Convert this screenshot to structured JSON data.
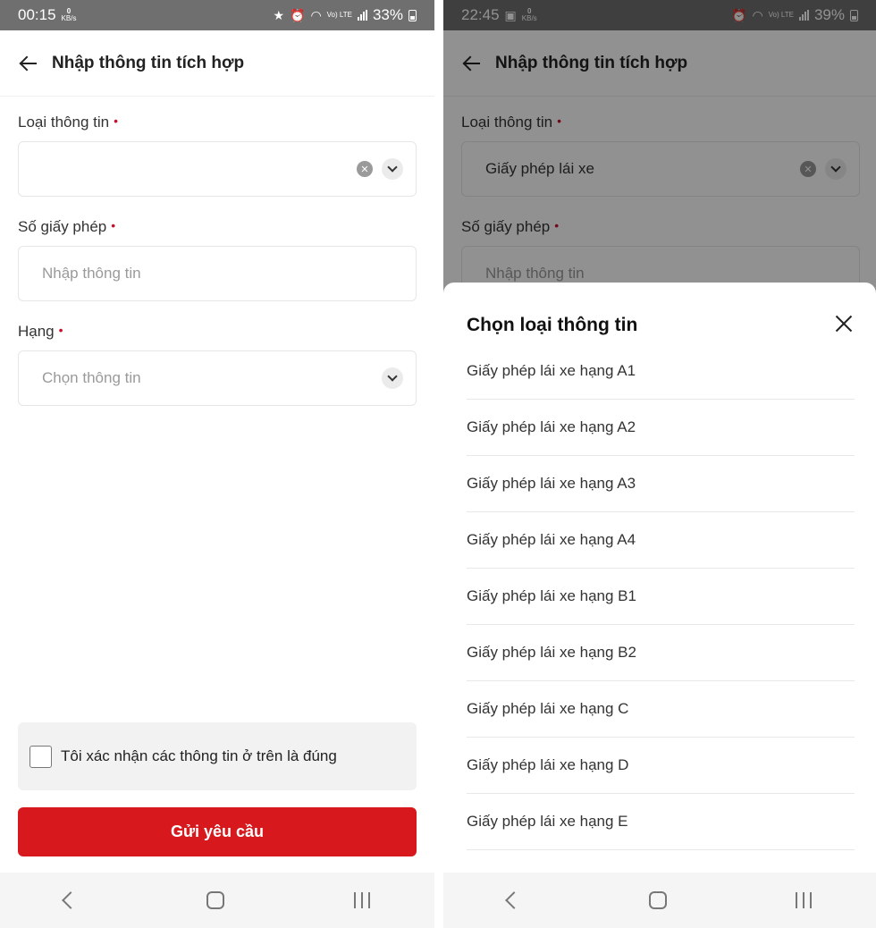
{
  "left": {
    "status": {
      "time": "00:15",
      "speed": "0",
      "speed_unit": "KB/s",
      "lte": "Vo) LTE",
      "battery": "33%"
    },
    "header": {
      "title": "Nhập thông tin tích hợp"
    },
    "fields": {
      "type_label": "Loại thông tin",
      "type_value": "",
      "license_label": "Số giấy phép",
      "license_placeholder": "Nhập thông tin",
      "class_label": "Hạng",
      "class_placeholder": "Chọn thông tin",
      "required_mark": "•"
    },
    "confirm_text": "Tôi xác nhận các thông tin ở trên là đúng",
    "submit_label": "Gửi yêu cầu"
  },
  "right": {
    "status": {
      "time": "22:45",
      "speed": "0",
      "speed_unit": "KB/s",
      "lte": "Vo) LTE",
      "battery": "39%"
    },
    "header": {
      "title": "Nhập thông tin tích hợp"
    },
    "fields": {
      "type_label": "Loại thông tin",
      "type_value": "Giấy phép lái xe",
      "license_label": "Số giấy phép",
      "license_placeholder": "Nhập thông tin",
      "required_mark": "•"
    },
    "sheet": {
      "title": "Chọn loại thông tin",
      "options": [
        "Giấy phép lái xe hạng A1",
        "Giấy phép lái xe hạng A2",
        "Giấy phép lái xe hạng A3",
        "Giấy phép lái xe hạng A4",
        "Giấy phép lái xe hạng B1",
        "Giấy phép lái xe hạng B2",
        "Giấy phép lái xe hạng C",
        "Giấy phép lái xe hạng D",
        "Giấy phép lái xe hạng E"
      ]
    }
  },
  "colors": {
    "primary": "#d7191e",
    "required": "#c8102e",
    "statusbar": "#6f6f6f"
  },
  "icons": [
    "back-arrow-icon",
    "clear-icon",
    "chevron-down-icon",
    "close-icon",
    "checkbox-icon",
    "nav-back-icon",
    "nav-home-icon",
    "nav-recent-icon",
    "star-icon",
    "alarm-icon",
    "wifi-icon",
    "signal-icon",
    "battery-icon",
    "image-icon"
  ]
}
